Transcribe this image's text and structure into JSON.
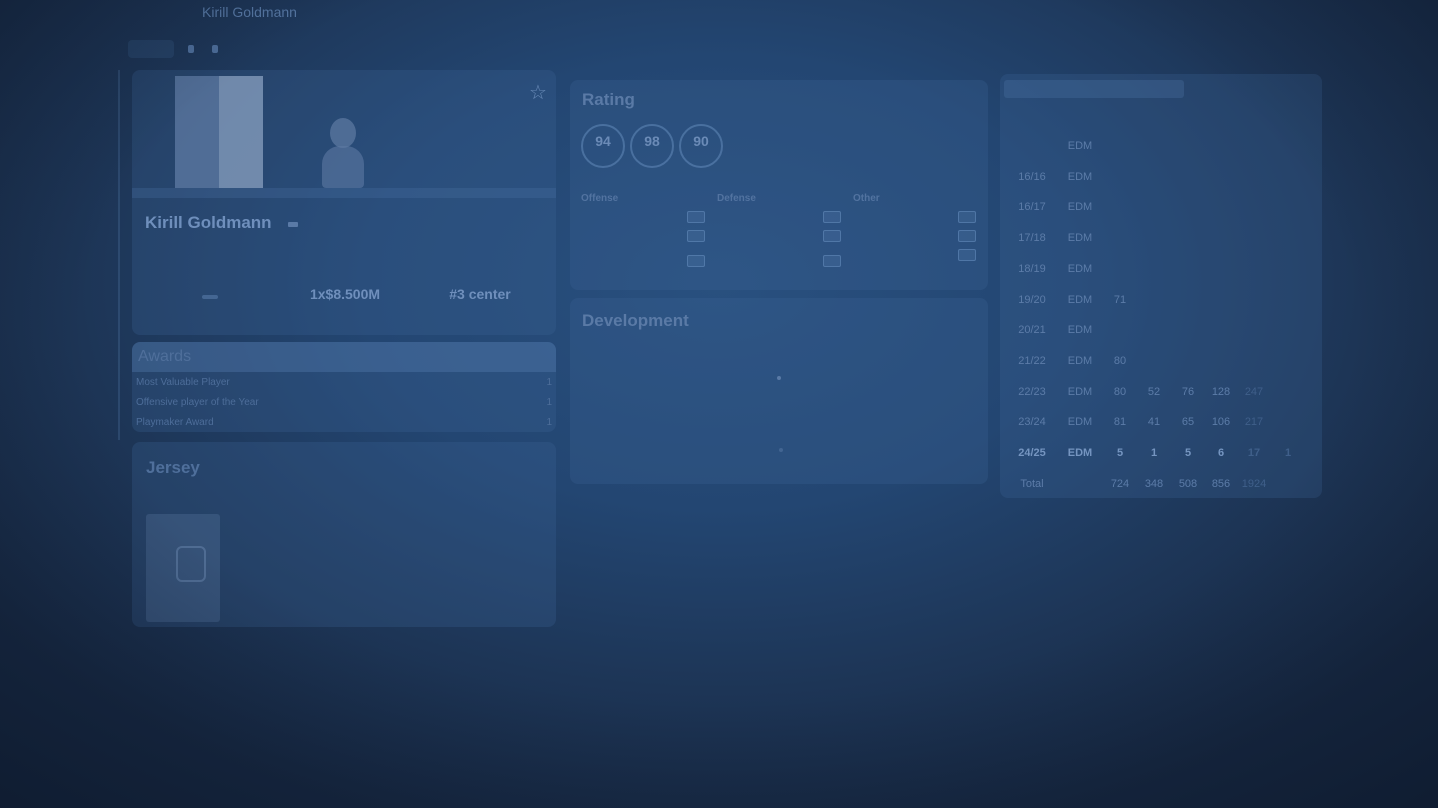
{
  "header": {
    "name": "Kirill Goldmann",
    "subtitle": "",
    "links": [
      {
        "label": "",
        "icon": "document-icon"
      },
      {
        "label": "",
        "icon": "person-icon"
      }
    ]
  },
  "player": {
    "name": "Kirill Goldmann",
    "meta_line1": "",
    "meta_line2": "",
    "status_pill": "",
    "status_label": "",
    "contract_value": "1x$8.500M",
    "contract_label": "",
    "rank_value": "#3 center",
    "rank_label": ""
  },
  "awards": {
    "title": "Awards",
    "items": [
      {
        "name": "Most Valuable Player",
        "count": "1"
      },
      {
        "name": "Offensive player of the Year",
        "count": "1"
      },
      {
        "name": "Playmaker Award",
        "count": "1"
      }
    ]
  },
  "jersey": {
    "title": "Jersey"
  },
  "rating": {
    "title": "Rating",
    "circles": [
      {
        "value": "94",
        "label": ""
      },
      {
        "value": "98",
        "label": ""
      },
      {
        "value": "90",
        "label": ""
      }
    ],
    "categories": [
      {
        "title": "Offense",
        "rows": [
          "",
          "",
          ""
        ]
      },
      {
        "title": "Defense",
        "rows": [
          "",
          "",
          ""
        ]
      },
      {
        "title": "Other",
        "rows": [
          "",
          "",
          ""
        ]
      }
    ]
  },
  "development": {
    "title": "Development",
    "footer": ""
  },
  "stats_table": {
    "columns": [
      "",
      "",
      "",
      "",
      "",
      "",
      ""
    ],
    "rows": [
      {
        "season": "",
        "team": "EDM",
        "gp": "",
        "g": "",
        "a": "",
        "p": "",
        "pim": "",
        "pm": ""
      },
      {
        "season": "16/16",
        "team": "EDM",
        "gp": "",
        "g": "",
        "a": "",
        "p": "",
        "pim": "",
        "pm": ""
      },
      {
        "season": "16/17",
        "team": "EDM",
        "gp": "",
        "g": "",
        "a": "",
        "p": "",
        "pim": "",
        "pm": ""
      },
      {
        "season": "17/18",
        "team": "EDM",
        "gp": "",
        "g": "",
        "a": "",
        "p": "",
        "pim": "",
        "pm": ""
      },
      {
        "season": "18/19",
        "team": "EDM",
        "gp": "",
        "g": "",
        "a": "",
        "p": "",
        "pim": "",
        "pm": ""
      },
      {
        "season": "19/20",
        "team": "EDM",
        "gp": "71",
        "g": "",
        "a": "",
        "p": "",
        "pim": "",
        "pm": ""
      },
      {
        "season": "20/21",
        "team": "EDM",
        "gp": "",
        "g": "",
        "a": "",
        "p": "",
        "pim": "",
        "pm": ""
      },
      {
        "season": "21/22",
        "team": "EDM",
        "gp": "80",
        "g": "",
        "a": "",
        "p": "",
        "pim": "",
        "pm": ""
      },
      {
        "season": "22/23",
        "team": "EDM",
        "gp": "80",
        "g": "52",
        "a": "76",
        "p": "128",
        "pim": "247",
        "pm": ""
      },
      {
        "season": "23/24",
        "team": "EDM",
        "gp": "81",
        "g": "41",
        "a": "65",
        "p": "106",
        "pim": "217",
        "pm": ""
      },
      {
        "season": "24/25",
        "team": "EDM",
        "gp": "5",
        "g": "1",
        "a": "5",
        "p": "6",
        "pim": "17",
        "pm": "1"
      },
      {
        "season": "Total",
        "team": "",
        "gp": "724",
        "g": "348",
        "a": "508",
        "p": "856",
        "pim": "1924",
        "pm": ""
      }
    ]
  }
}
